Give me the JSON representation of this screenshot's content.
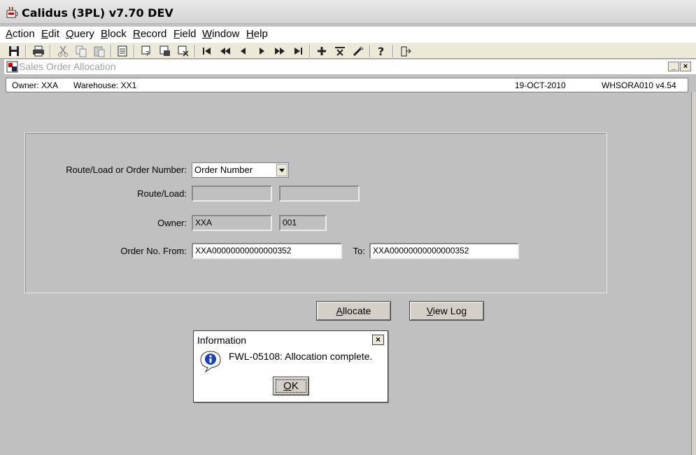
{
  "window": {
    "title": "Calidus (3PL) v7.70 DEV"
  },
  "menu": [
    {
      "accel": "A",
      "rest": "ction"
    },
    {
      "accel": "E",
      "rest": "dit"
    },
    {
      "accel": "Q",
      "rest": "uery"
    },
    {
      "accel": "B",
      "rest": "lock"
    },
    {
      "accel": "R",
      "rest": "ecord"
    },
    {
      "accel": "F",
      "rest": "ield"
    },
    {
      "accel": "W",
      "rest": "indow"
    },
    {
      "accel": "H",
      "rest": "elp"
    }
  ],
  "inner_window": {
    "title": "Sales Order Allocation",
    "minimize": "_",
    "close": "×"
  },
  "header": {
    "owner": "Owner:  XXA",
    "warehouse": "Warehouse:  XX1",
    "date": "19-OCT-2010",
    "form_id": "WHSORA010  v4.54"
  },
  "form": {
    "route_or_order_label": "Route/Load or Order Number:",
    "route_or_order_value": "Order Number",
    "route_load_label": "Route/Load:",
    "route_load_value1": "",
    "route_load_value2": "",
    "owner_label": "Owner:",
    "owner_value": "XXA",
    "owner_code": "001",
    "order_from_label": "Order No. From:",
    "order_from_value": "XXA00000000000000352",
    "order_to_label": "To:",
    "order_to_value": "XXA00000000000000352"
  },
  "buttons": {
    "allocate_accel": "A",
    "allocate_rest": "llocate",
    "viewlog_accel": "V",
    "viewlog_rest": "iew Log"
  },
  "dialog": {
    "title": "Information",
    "close": "×",
    "message": "FWL-05108:  Allocation complete.",
    "ok_accel": "O",
    "ok_rest": "K"
  },
  "icons": {
    "toolbar": [
      "save-icon",
      "print-icon",
      "cut-icon",
      "copy-icon",
      "paste-icon",
      "list-icon",
      "query-enter-icon",
      "query-execute-icon",
      "query-cancel-icon",
      "first-record-icon",
      "previous-block-icon",
      "previous-record-icon",
      "next-record-icon",
      "next-block-icon",
      "last-record-icon",
      "insert-record-icon",
      "delete-record-icon",
      "clear-record-icon",
      "help-icon",
      "exit-icon"
    ]
  }
}
